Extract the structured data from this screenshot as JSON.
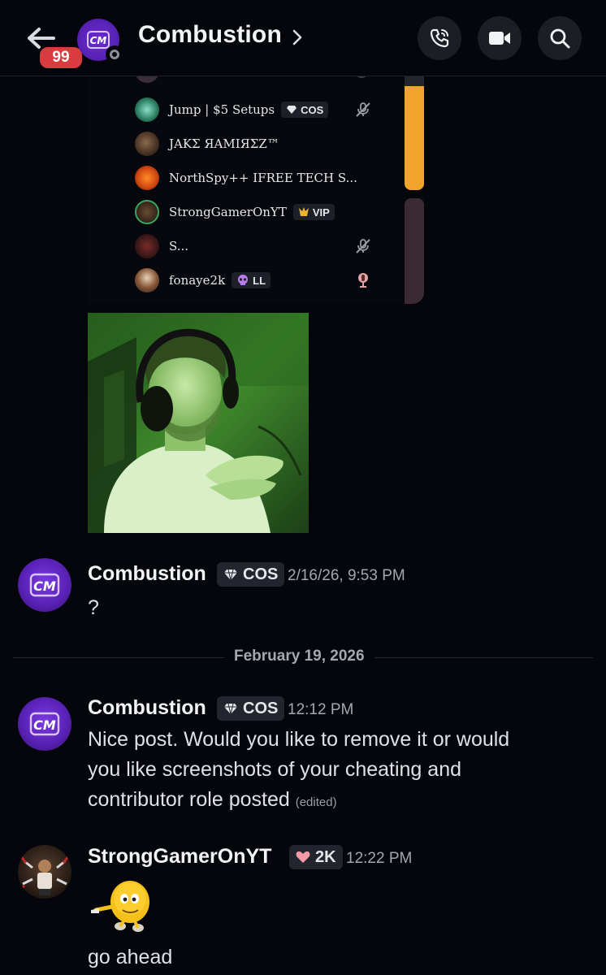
{
  "header": {
    "back_label": "Back",
    "unread_count": "99",
    "channel_title": "Combustion",
    "avatar_initials": "CM"
  },
  "embed": {
    "members": [
      {
        "name": "Jump | $5 Setups",
        "tag": "COS",
        "tag_icon": "diamond-icon",
        "right_icon": "mic-muted-icon"
      },
      {
        "name": "JAKΣ ЯAMIЯΣZ™",
        "tag": "",
        "tag_icon": "",
        "right_icon": ""
      },
      {
        "name": "NorthSpy++ IFREE TECH S...",
        "tag": "",
        "tag_icon": "",
        "right_icon": ""
      },
      {
        "name": "StrongGamerOnYT",
        "tag": "VIP",
        "tag_icon": "vip-crest-icon",
        "right_icon": ""
      },
      {
        "name": "S...",
        "tag": "",
        "tag_icon": "",
        "right_icon": "mic-muted-icon"
      },
      {
        "name": "fonaye2k",
        "tag": "LL",
        "tag_icon": "skull-icon",
        "right_icon": "mic-icon"
      }
    ]
  },
  "messages": [
    {
      "author": "Combustion",
      "role": "COS",
      "role_icon": "diamond-icon",
      "time": "2/16/26, 9:53 PM",
      "lines": [
        "?"
      ]
    },
    {
      "author": "Combustion",
      "role": "COS",
      "role_icon": "diamond-icon",
      "time": "12:12 PM",
      "lines": [
        "Nice post. Would you like to remove it or would",
        "you like screenshots of your cheating and",
        "contributor role posted"
      ],
      "edited": "(edited)"
    },
    {
      "author": "StrongGamerOnYT",
      "role": "2K",
      "role_icon": "heart-icon",
      "time": "12:22 PM",
      "lines": [
        "go ahead"
      ]
    }
  ],
  "date_divider": "February 19, 2026",
  "colors": {
    "background": "#05060c",
    "unread_badge": "#d83c3e",
    "brand_purple": "#5a22b8",
    "embed_orange": "#f1a42c"
  }
}
